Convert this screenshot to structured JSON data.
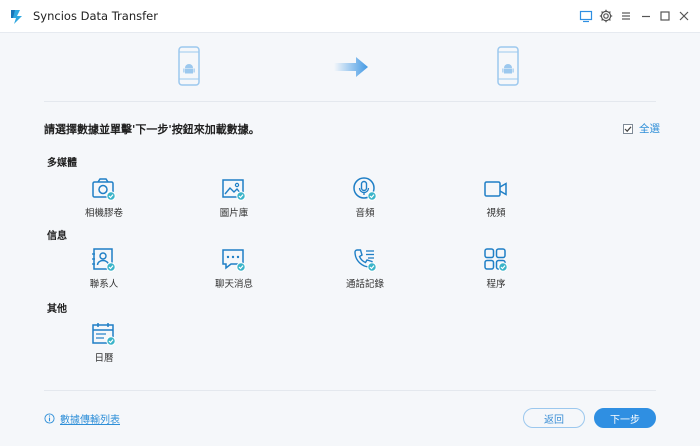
{
  "window": {
    "title": "Syncios Data Transfer",
    "logo_icon": "syncios-logo-icon",
    "controls": [
      "screen-icon",
      "gear-icon",
      "menu-icon",
      "minimize-icon",
      "maximize-icon",
      "close-icon"
    ]
  },
  "devices": {
    "source_icon": "android-phone-icon",
    "target_icon": "android-phone-icon",
    "direction_icon": "arrow-right-icon"
  },
  "instruction": "請選擇數據並單擊'下一步'按鈕來加載數據。",
  "select_all": {
    "label": "全選",
    "checked": true
  },
  "sections": [
    {
      "label": "多媒體",
      "items": [
        {
          "label": "相機膠卷",
          "icon": "camera-icon",
          "checked": true
        },
        {
          "label": "圖片庫",
          "icon": "image-icon",
          "checked": true
        },
        {
          "label": "音頻",
          "icon": "microphone-icon",
          "checked": true
        },
        {
          "label": "視頻",
          "icon": "video-icon",
          "checked": false
        }
      ]
    },
    {
      "label": "信息",
      "items": [
        {
          "label": "聯系人",
          "icon": "contact-icon",
          "checked": true
        },
        {
          "label": "聊天消息",
          "icon": "message-icon",
          "checked": true
        },
        {
          "label": "通話記錄",
          "icon": "call-log-icon",
          "checked": true
        },
        {
          "label": "程序",
          "icon": "apps-icon",
          "checked": true
        }
      ]
    },
    {
      "label": "其他",
      "items": [
        {
          "label": "日曆",
          "icon": "calendar-icon",
          "checked": true
        }
      ]
    }
  ],
  "footer": {
    "link_label": "數據傳輸列表",
    "back_label": "返回",
    "next_label": "下一步"
  },
  "colors": {
    "accent": "#2f8fe2",
    "icon_blue": "#1f7fc6",
    "check_badge": "#3ab4c9",
    "background": "#f5f7fa"
  }
}
